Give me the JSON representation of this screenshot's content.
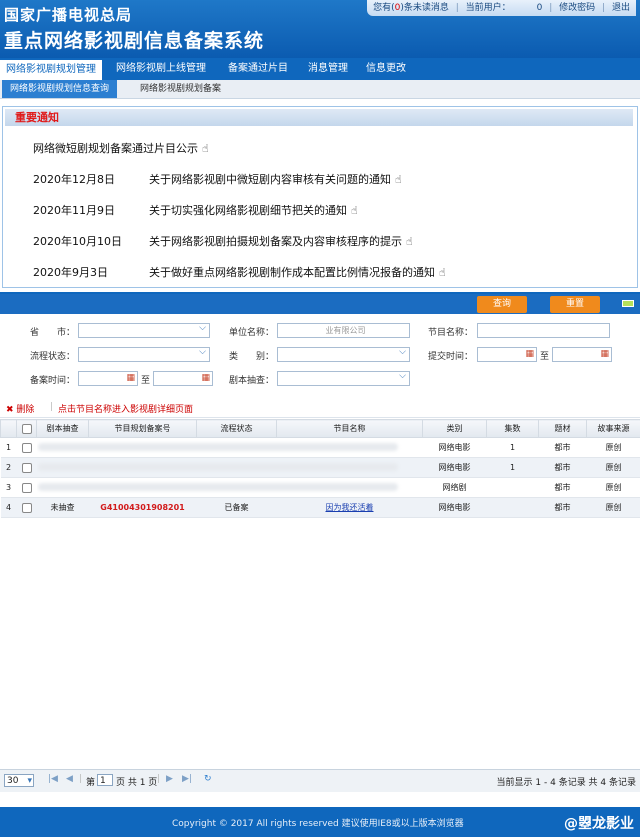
{
  "header": {
    "org": "国家广播电视总局",
    "system": "重点网络影视剧信息备案系统",
    "unread_prefix": "您有(",
    "unread_count": "0",
    "unread_suffix": ")条未读消息",
    "current_user_label": "当前用户：",
    "current_user_value": "0",
    "change_password": "修改密码",
    "logout": "退出"
  },
  "nav": {
    "tabs": [
      {
        "label": "网络影视剧规划管理"
      },
      {
        "label": "网络影视剧上线管理"
      },
      {
        "label": "备案通过片目"
      },
      {
        "label": "消息管理"
      },
      {
        "label": "信息更改"
      }
    ],
    "subtabs": [
      {
        "label": "网络影视剧规划信息查询"
      },
      {
        "label": "网络影视剧规划备案"
      }
    ]
  },
  "notice": {
    "title": "重要通知",
    "items": [
      {
        "date": "",
        "text": "网络微短剧规划备案通过片目公示"
      },
      {
        "date": "2020年12月8日",
        "text": "关于网络影视剧中微短剧内容审核有关问题的通知"
      },
      {
        "date": "2020年11月9日",
        "text": "关于切实强化网络影视剧细节把关的通知"
      },
      {
        "date": "2020年10月10日",
        "text": "关于网络影视剧拍摄规划备案及内容审核程序的提示"
      },
      {
        "date": "2020年9月3日",
        "text": "关于做好重点网络影视剧制作成本配置比例情况报备的通知"
      }
    ],
    "hand_glyph": "☝"
  },
  "search": {
    "query_button": "查询",
    "reset_button": "重置",
    "labels": {
      "province": "省　　市：",
      "org": "单位名称：",
      "title": "节目名称：",
      "status": "流程状态：",
      "category": "类　　别：",
      "submit_time": "提交时间：",
      "record_time": "备案时间：",
      "script_check": "剧本抽查：",
      "to1": "至",
      "to2": "至"
    },
    "org_value": "业有限公司"
  },
  "toolbar": {
    "delete": "删除",
    "hint": "点击节目名称进入影视剧详细页面"
  },
  "table": {
    "headers": [
      "",
      "",
      "剧本抽查",
      "节目规划备案号",
      "流程状态",
      "节目名称",
      "类别",
      "集数",
      "题材",
      "故事来源"
    ],
    "rows": [
      {
        "no": "1",
        "check": "",
        "code": "",
        "status": "",
        "name": "",
        "category": "网络电影",
        "episodes": "1",
        "theme": "都市",
        "source": "原创"
      },
      {
        "no": "2",
        "check": "",
        "code": "",
        "status": "",
        "name": "",
        "category": "网络电影",
        "episodes": "1",
        "theme": "都市",
        "source": "原创"
      },
      {
        "no": "3",
        "check": "",
        "code": "",
        "status": "",
        "name": "",
        "category": "网络剧",
        "episodes": "",
        "theme": "都市",
        "source": "原创"
      },
      {
        "no": "4",
        "check": "未抽查",
        "code": "G41004301908201",
        "status": "已备案",
        "name": "因为我还活着",
        "category": "网络电影",
        "episodes": "",
        "theme": "都市",
        "source": "原创"
      }
    ]
  },
  "pager": {
    "page_size": "30",
    "page_prefix": "第",
    "page_value": "1",
    "page_suffix": "页 共 1 页",
    "summary": "当前显示 1 - 4 条记录 共 4 条记录"
  },
  "footer": {
    "copyright": "Copyright © 2017 All rights reserved 建议使用IE8或以上版本浏览器",
    "watermark": "@曌龙影业"
  }
}
